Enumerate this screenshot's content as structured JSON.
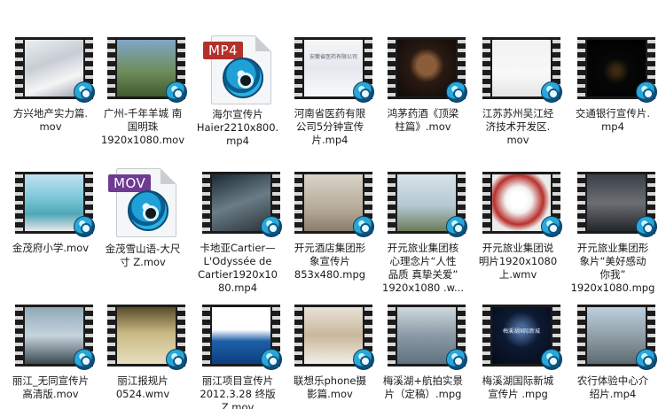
{
  "files": [
    {
      "name": "方兴地产实力篇.mov",
      "lines": [
        "方兴地产实力篇.",
        "mov"
      ],
      "kind": "video"
    },
    {
      "name": "广州-千年羊城 南国明珠 1920x1080.mov",
      "lines": [
        "广州-千年羊城 南",
        "国明珠",
        "1920x1080.mov"
      ],
      "kind": "video"
    },
    {
      "name": "海尔宣传片 Haier2210x800.mp4",
      "lines": [
        "海尔宣传片",
        "Haier2210x800.",
        "mp4"
      ],
      "kind": "doc",
      "tag": "MP4"
    },
    {
      "name": "河南省医药有限公司5分钟宣传片.mp4",
      "lines": [
        "河南省医药有限",
        "公司5分钟宣传",
        "片.mp4"
      ],
      "kind": "video"
    },
    {
      "name": "鸿茅药酒《顶梁柱篇》.mov",
      "lines": [
        "鸿茅药酒《顶梁",
        "柱篇》.mov"
      ],
      "kind": "video"
    },
    {
      "name": "江苏苏州吴江经济技术开发区.mov",
      "lines": [
        "江苏苏州吴江经",
        "济技术开发区.",
        "mov"
      ],
      "kind": "video"
    },
    {
      "name": "交通银行宣传片.mp4",
      "lines": [
        "交通银行宣传片.",
        "mp4"
      ],
      "kind": "video"
    },
    {
      "name": "金茂府小学.mov",
      "lines": [
        "金茂府小学.mov"
      ],
      "kind": "video"
    },
    {
      "name": "金茂雪山语-大尺寸 Z.mov",
      "lines": [
        "金茂雪山语-大尺",
        "寸 Z.mov"
      ],
      "kind": "doc",
      "tag": "MOV"
    },
    {
      "name": "卡地亚Cartier—L'Odyssée de Cartier1920x1080.mp4",
      "lines": [
        "卡地亚Cartier—",
        "L'Odyssée de",
        "Cartier1920x10",
        "80.mp4"
      ],
      "kind": "video"
    },
    {
      "name": "开元酒店集团形象宣传片 853x480.mpg",
      "lines": [
        "开元酒店集团形",
        "象宣传片",
        "853x480.mpg"
      ],
      "kind": "video"
    },
    {
      "name": "开元旅业集团核心理念片“人性品质 真挚关爱” 1920x1080 .wmv",
      "lines": [
        "开元旅业集团核",
        "心理念片“人性",
        "品质 真挚关爱”",
        "1920x1080 .w..."
      ],
      "kind": "video"
    },
    {
      "name": "开元旅业集团说明片1920x1080上.wmv",
      "lines": [
        "开元旅业集团说",
        "明片1920x1080",
        "上.wmv"
      ],
      "kind": "video"
    },
    {
      "name": "开元旅业集团形象片“美好感动你我” 1920x1080.mpg",
      "lines": [
        "开元旅业集团形",
        "象片“美好感动",
        "你我”",
        "1920x1080.mpg"
      ],
      "kind": "video"
    },
    {
      "name": "丽江_无同宣传片高清版.mov",
      "lines": [
        "丽江_无同宣传片",
        "高清版.mov"
      ],
      "kind": "video"
    },
    {
      "name": "丽江报规片0524.wmv",
      "lines": [
        "丽江报规片",
        "0524.wmv"
      ],
      "kind": "video"
    },
    {
      "name": "丽江项目宣传片2012.3.28 终版Z.mov",
      "lines": [
        "丽江项目宣传片",
        "2012.3.28 终版",
        "Z.mov"
      ],
      "kind": "video"
    },
    {
      "name": "联想乐phone摄影篇.mov",
      "lines": [
        "联想乐phone摄",
        "影篇.mov"
      ],
      "kind": "video"
    },
    {
      "name": "梅溪湖+航拍实景片（定稿）.mpg",
      "lines": [
        "梅溪湖+航拍实景",
        "片（定稿）.mpg"
      ],
      "kind": "video"
    },
    {
      "name": "梅溪湖国际新城宣传片 .mpg",
      "lines": [
        "梅溪湖国际新城",
        "宣传片 .mpg"
      ],
      "kind": "video"
    },
    {
      "name": "农行体验中心介绍片.mp4",
      "lines": [
        "农行体验中心介",
        "绍片.mp4"
      ],
      "kind": "video"
    }
  ],
  "thumb_captions": {
    "f3": "安徽省医药有限公司",
    "f19": "梅溪湖国际新城"
  },
  "colors": {
    "mp4_tag": "#b3312b",
    "mov_tag": "#6f3a91",
    "badge": "#2aa7d8"
  },
  "icons": {
    "badge": "quicktime-disc-icon",
    "doc": "video-file-icon"
  }
}
